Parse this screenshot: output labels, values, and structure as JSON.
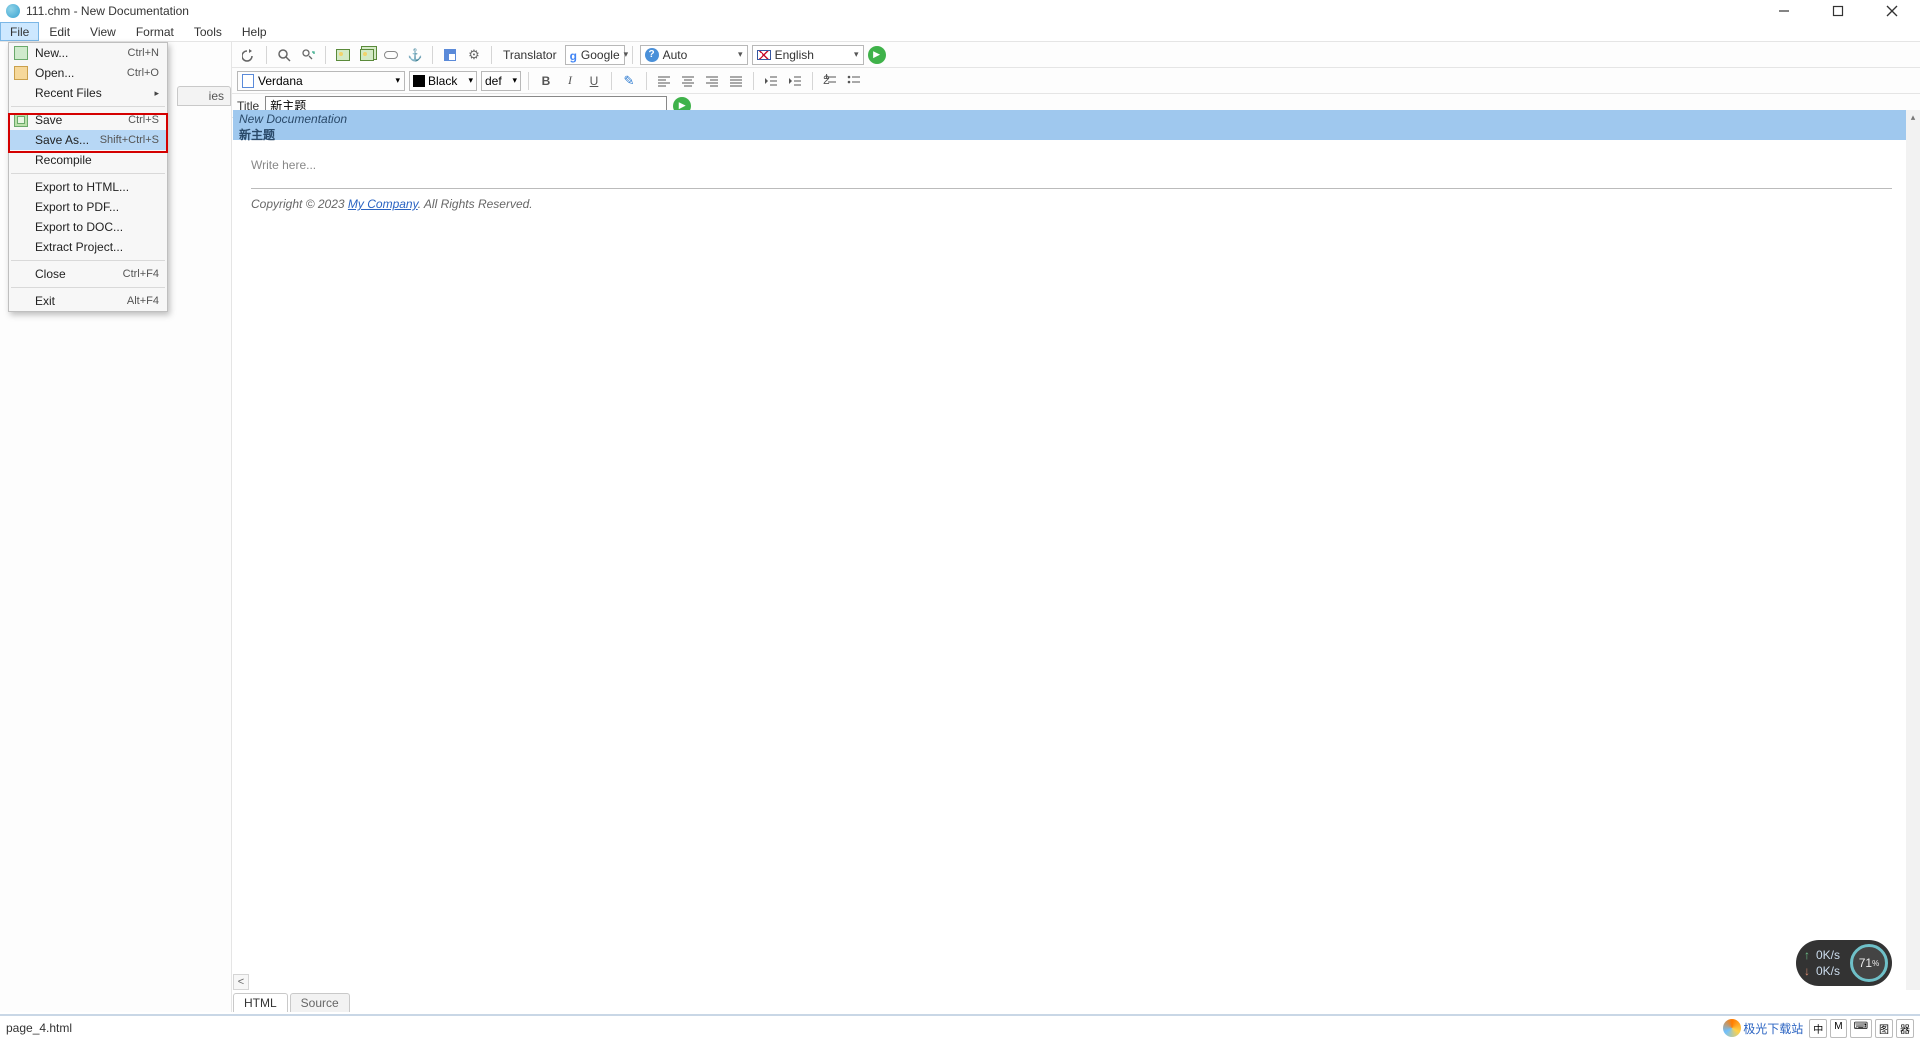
{
  "window": {
    "title": "111.chm - New Documentation"
  },
  "menubar": [
    "File",
    "Edit",
    "View",
    "Format",
    "Tools",
    "Help"
  ],
  "file_menu": {
    "new": {
      "label": "New...",
      "shortcut": "Ctrl+N"
    },
    "open": {
      "label": "Open...",
      "shortcut": "Ctrl+O"
    },
    "recent": {
      "label": "Recent Files"
    },
    "save": {
      "label": "Save",
      "shortcut": "Ctrl+S"
    },
    "save_as": {
      "label": "Save As...",
      "shortcut": "Shift+Ctrl+S"
    },
    "recompile": {
      "label": "Recompile"
    },
    "export_html": {
      "label": "Export to HTML..."
    },
    "export_pdf": {
      "label": "Export to PDF..."
    },
    "export_doc": {
      "label": "Export to DOC..."
    },
    "extract": {
      "label": "Extract Project..."
    },
    "close": {
      "label": "Close",
      "shortcut": "Ctrl+F4"
    },
    "exit": {
      "label": "Exit",
      "shortcut": "Alt+F4"
    }
  },
  "toolbar1": {
    "translator_label": "Translator",
    "provider": "Google",
    "source_lang": "Auto",
    "target_lang": "English"
  },
  "toolbar2": {
    "font": "Verdana",
    "color_name": "Black",
    "size": "def"
  },
  "title_row": {
    "label": "Title",
    "value": "新主题"
  },
  "left_panel": {
    "tab_peek": "ies"
  },
  "breadcrumb": {
    "project": "New Documentation",
    "topic": "新主题"
  },
  "editor": {
    "placeholder": "Write here...",
    "copyright_prefix": "Copyright © 2023 ",
    "company": "My Company",
    "copyright_suffix": ". All Rights Reserved."
  },
  "bottom_tabs": {
    "html": "HTML",
    "source": "Source"
  },
  "statusbar": {
    "text": "page_4.html",
    "site": "极光下载站",
    "ime": [
      "中",
      "M",
      "⌨",
      "图",
      "器"
    ]
  },
  "speed_widget": {
    "up_rate": "0K/s",
    "down_rate": "0K/s",
    "percent": "71",
    "percent_unit": "%"
  }
}
